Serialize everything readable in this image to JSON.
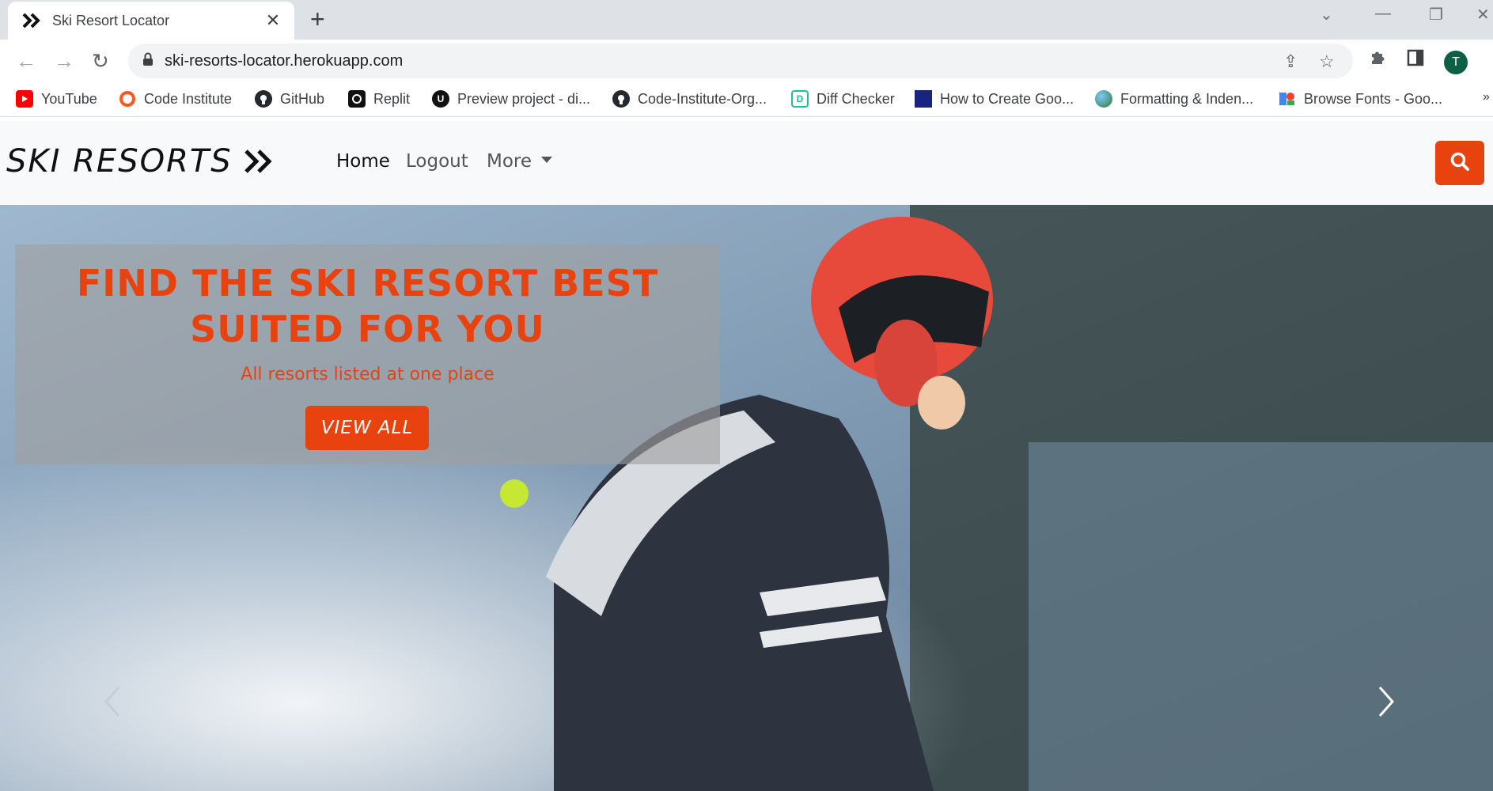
{
  "browser": {
    "tab_title": "Ski Resort Locator",
    "url": "ski-resorts-locator.herokuapp.com",
    "avatar_initial": "T",
    "bookmarks": [
      {
        "label": "YouTube",
        "icon": "youtube-icon"
      },
      {
        "label": "Code Institute",
        "icon": "code-institute-icon"
      },
      {
        "label": "GitHub",
        "icon": "github-icon"
      },
      {
        "label": "Replit",
        "icon": "replit-icon"
      },
      {
        "label": "Preview project - di...",
        "icon": "udacity-icon"
      },
      {
        "label": "Code-Institute-Org...",
        "icon": "github-icon"
      },
      {
        "label": "Diff Checker",
        "icon": "diffchecker-icon"
      },
      {
        "label": "How to Create Goo...",
        "icon": "site-wizard-icon"
      },
      {
        "label": "Formatting & Inden...",
        "icon": "globe-icon"
      },
      {
        "label": "Browse Fonts - Goo...",
        "icon": "google-fonts-icon"
      }
    ]
  },
  "site": {
    "brand": "SKI RESORTS",
    "nav": {
      "home": "Home",
      "logout": "Logout",
      "more": "More"
    },
    "hero": {
      "title": "FIND THE SKI RESORT BEST SUITED FOR YOU",
      "subtitle": "All resorts listed at one place",
      "cta": "VIEW ALL"
    }
  },
  "colors": {
    "accent": "#e8430e",
    "navbar_bg": "#f8f9fa",
    "chrome_bg": "#dee1e6"
  }
}
